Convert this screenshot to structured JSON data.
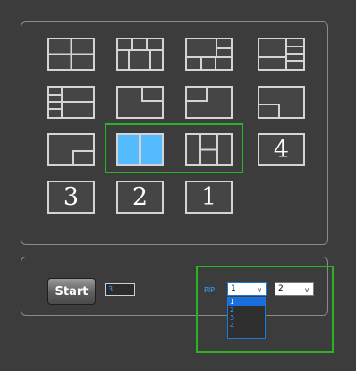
{
  "layouts": {
    "number_tiles": {
      "four": "4",
      "three": "3",
      "two": "2",
      "one": "1"
    },
    "selected_tile": "two-column-split"
  },
  "controls": {
    "start_label": "Start",
    "count_value": "3",
    "pip_label": "PIP:",
    "pip_select_1": {
      "value": "1",
      "options": [
        "1",
        "2",
        "3",
        "4"
      ]
    },
    "pip_select_2": {
      "value": "2"
    }
  },
  "colors": {
    "selected_tile": "#55bbff",
    "highlight": "#2bb324",
    "accent_text": "#3aa0ff",
    "dropdown_active": "#1a6fe0"
  }
}
